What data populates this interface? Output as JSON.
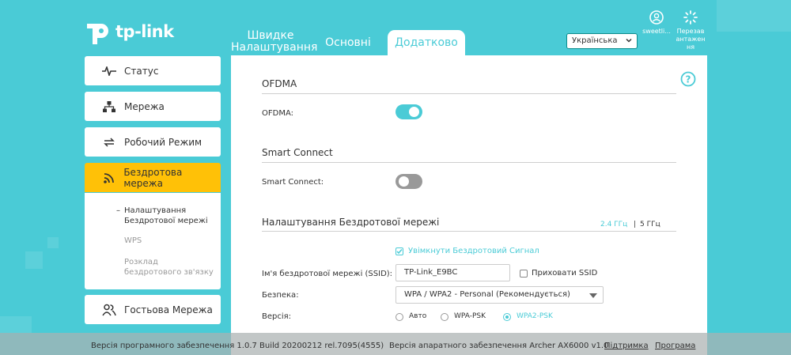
{
  "brand": {
    "name": "tp-link"
  },
  "tabs": [
    {
      "label": "Швидке Налаштування"
    },
    {
      "label": "Основні"
    },
    {
      "label": "Додатково"
    }
  ],
  "language": {
    "selected": "Українська"
  },
  "header_buttons": {
    "user": "sweetli...",
    "reboot": "Перезав антажен ня"
  },
  "sidebar": {
    "items": [
      {
        "label": "Статус",
        "icon": "pulse-icon"
      },
      {
        "label": "Мережа",
        "icon": "network-icon"
      },
      {
        "label": "Робочий Режим",
        "icon": "mode-swap-icon"
      },
      {
        "label": "Бездротова мережа",
        "icon": "wifi-icon"
      },
      {
        "label": "Гостьова Мережа",
        "icon": "guests-icon"
      }
    ],
    "subitems": [
      {
        "label": "Налаштування Бездротової мережі"
      },
      {
        "label": "WPS"
      },
      {
        "label": "Розклад бездротового зв'язку"
      }
    ]
  },
  "main": {
    "ofdma": {
      "title": "OFDMA",
      "label": "OFDMA:",
      "enabled": true
    },
    "smart_connect": {
      "title": "Smart Connect",
      "label": "Smart Connect:",
      "enabled": false
    },
    "wireless": {
      "title": "Налаштування Бездротової мережі",
      "band_24": "2.4 ГГц",
      "band_sep": "|",
      "band_5": "5 ГГц",
      "enable_label": "Увімкнути Бездротовий Сигнал",
      "ssid_label": "Ім'я бездротової мережі (SSID):",
      "ssid_value": "TP-Link_E9BC",
      "hide_ssid_label": "Приховати SSID",
      "security_label": "Безпека:",
      "security_value": "WPA / WPA2 - Personal (Рекомендується)",
      "version_label": "Версія:",
      "version_options": [
        "Авто",
        "WPA-PSK",
        "WPA2-PSK"
      ],
      "version_selected": "WPA2-PSK"
    }
  },
  "footer": {
    "firmware": "Версія програмного забезпечення 1.0.7 Build 20200212 rel.7095(4555)",
    "hardware": "Версія апаратного забезпечення Archer AX6000 v1.0",
    "support": "Підтримка",
    "app": "Програма"
  },
  "colors": {
    "accent": "#4acbd6",
    "active": "#ffc107",
    "background": "#4acbd6"
  }
}
